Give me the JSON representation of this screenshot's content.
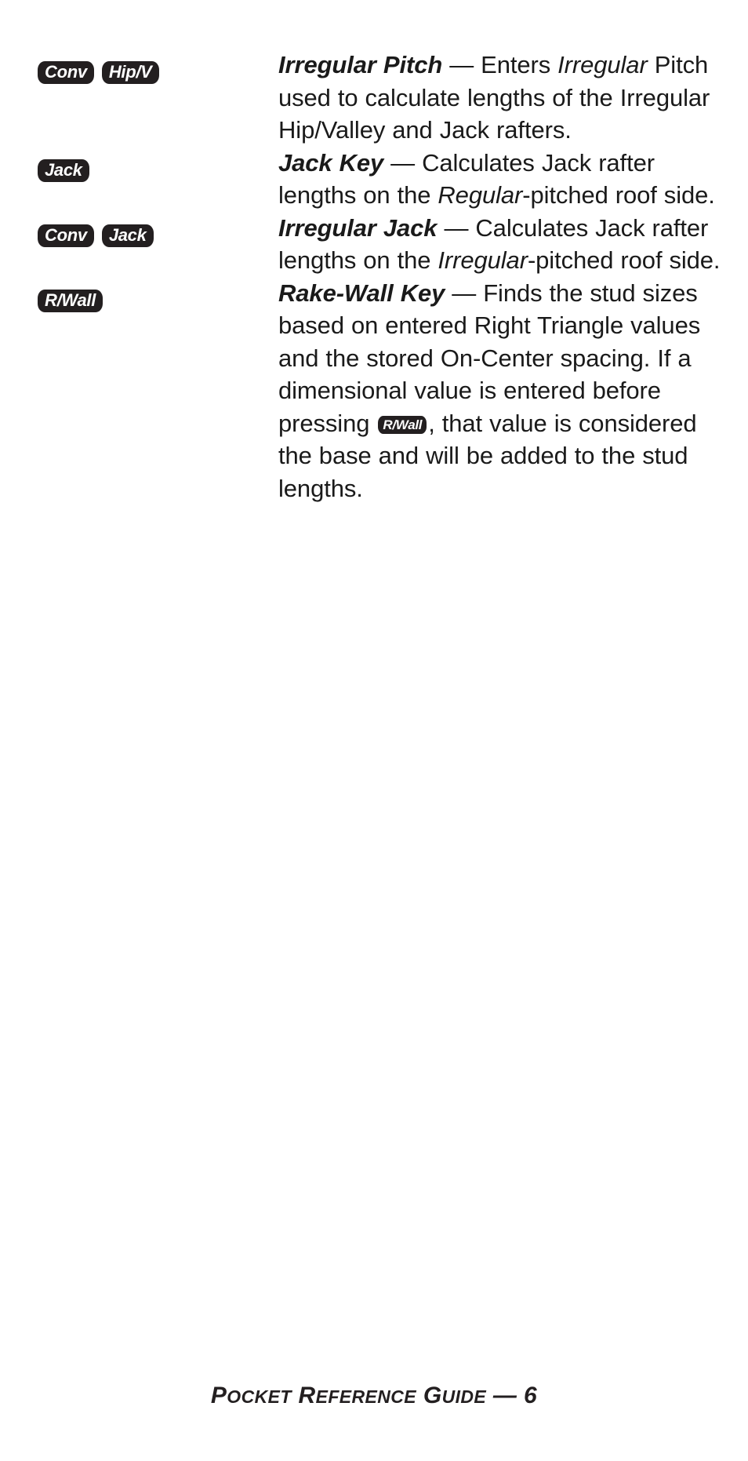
{
  "page": {
    "footer_prefix": "P",
    "footer": "POCKET REFERENCE GUIDE — 6",
    "page_number": "6"
  },
  "footer_parts": {
    "p1_cap": "P",
    "p1_rest": "OCKET",
    "p2_cap": "R",
    "p2_rest": "EFERENCE",
    "p3_cap": "G",
    "p3_rest": "UIDE",
    "dash": "—",
    "number": "6"
  },
  "entries": [
    {
      "keys": [
        "Conv",
        "Hip/V"
      ],
      "title": "Irregular Pitch",
      "dash": " — ",
      "body_1": "Enters ",
      "body_em": "Irregular",
      "body_2": " Pitch used to calculate lengths of the Irregular Hip/Valley and Jack rafters."
    },
    {
      "keys": [
        "Jack"
      ],
      "title": "Jack Key",
      "dash": " — ",
      "body_1": "Calculates Jack rafter lengths on the ",
      "body_em": "Regular",
      "body_2": "-pitched roof side."
    },
    {
      "keys": [
        "Conv",
        "Jack"
      ],
      "title": "Irregular Jack",
      "dash": " — ",
      "body_1": "Calculates Jack rafter lengths on the ",
      "body_em": "Irregular",
      "body_2": "-pitched roof side."
    },
    {
      "keys": [
        "R/Wall"
      ],
      "title": "Rake-Wall Key",
      "dash": " — ",
      "body_1": "Finds the stud sizes based on entered Right Triangle values and the stored On-Center spacing. If a dimensional value is entered before pressing ",
      "inline_key": "R/Wall",
      "body_2": ", that value is considered the base and will be added to the stud lengths."
    }
  ],
  "colors": {
    "text": "#1a1a1a",
    "keycap_bg": "#231f20",
    "keycap_fg": "#ffffff",
    "page_bg": "#ffffff"
  }
}
